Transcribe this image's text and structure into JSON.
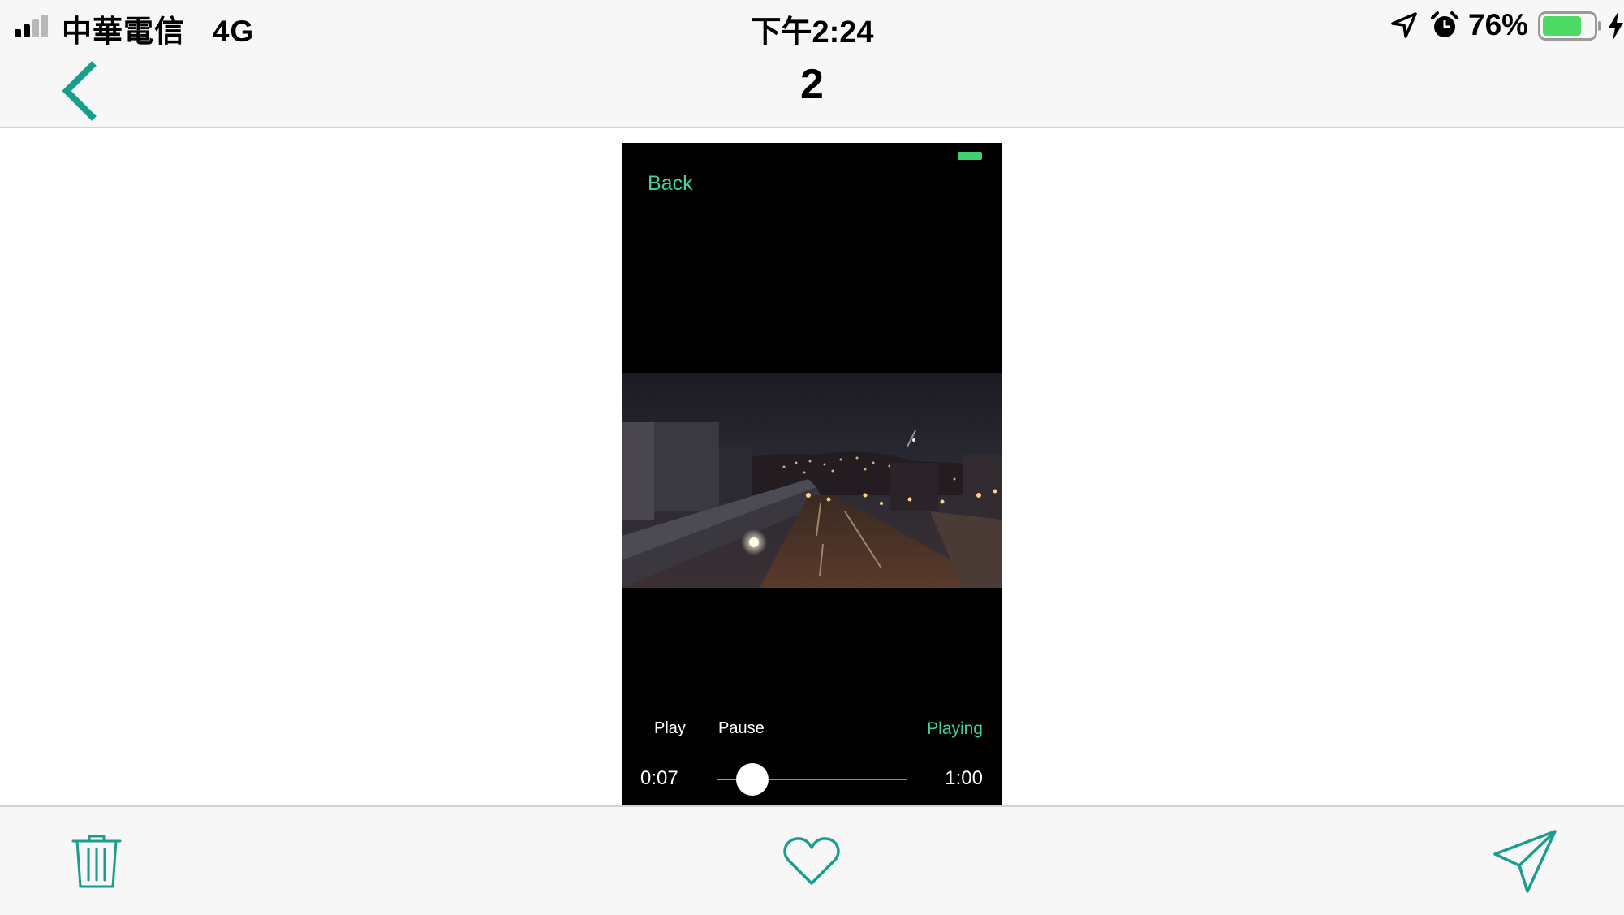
{
  "status_bar": {
    "carrier": "中華電信",
    "network": "4G",
    "time": "下午2:24",
    "battery_percent": "76%",
    "battery_level": 0.76,
    "battery_color": "#4cd964",
    "icons": [
      "signal-icon",
      "location-arrow-icon",
      "alarm-icon",
      "battery-icon",
      "charging-bolt-icon"
    ]
  },
  "nav": {
    "title": "2",
    "back_icon": "chevron-left-icon",
    "accent_color": "#1a9e8c"
  },
  "player": {
    "back_label": "Back",
    "play_label": "Play",
    "pause_label": "Pause",
    "status_label": "Playing",
    "current_time": "0:07",
    "total_time": "1:00",
    "progress": 0.117,
    "accent_color": "#3fd1a3"
  },
  "toolbar": {
    "icons": [
      "trash-icon",
      "heart-icon",
      "send-icon"
    ]
  }
}
